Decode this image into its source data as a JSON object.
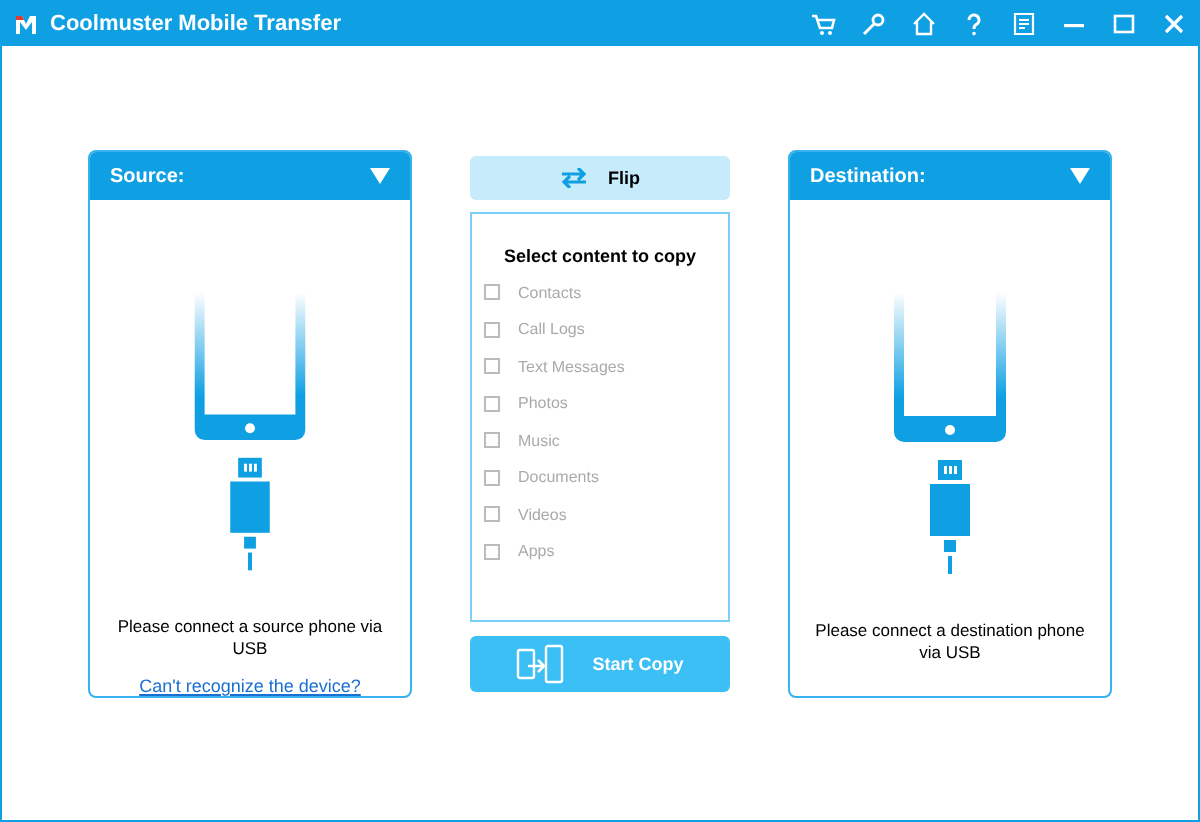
{
  "window": {
    "title": "Coolmuster Mobile Transfer"
  },
  "source": {
    "title": "Source:",
    "message": "Please connect a source phone via USB",
    "link": "Can't recognize the device?"
  },
  "flip_button": {
    "label": "Flip"
  },
  "content": {
    "title": "Select content to copy",
    "items": [
      {
        "label": "Contacts",
        "checked": false,
        "disabled": true
      },
      {
        "label": "Call Logs",
        "checked": false,
        "disabled": true
      },
      {
        "label": "Text Messages",
        "checked": false,
        "disabled": true
      },
      {
        "label": "Photos",
        "checked": false,
        "disabled": true
      },
      {
        "label": "Music",
        "checked": false,
        "disabled": true
      },
      {
        "label": "Documents",
        "checked": false,
        "disabled": true
      },
      {
        "label": "Videos",
        "checked": false,
        "disabled": true
      },
      {
        "label": "Apps",
        "checked": false,
        "disabled": true
      }
    ]
  },
  "start_button": {
    "label": "Start Copy"
  },
  "destination": {
    "title": "Destination:",
    "message": "Please connect a destination phone via USB"
  }
}
